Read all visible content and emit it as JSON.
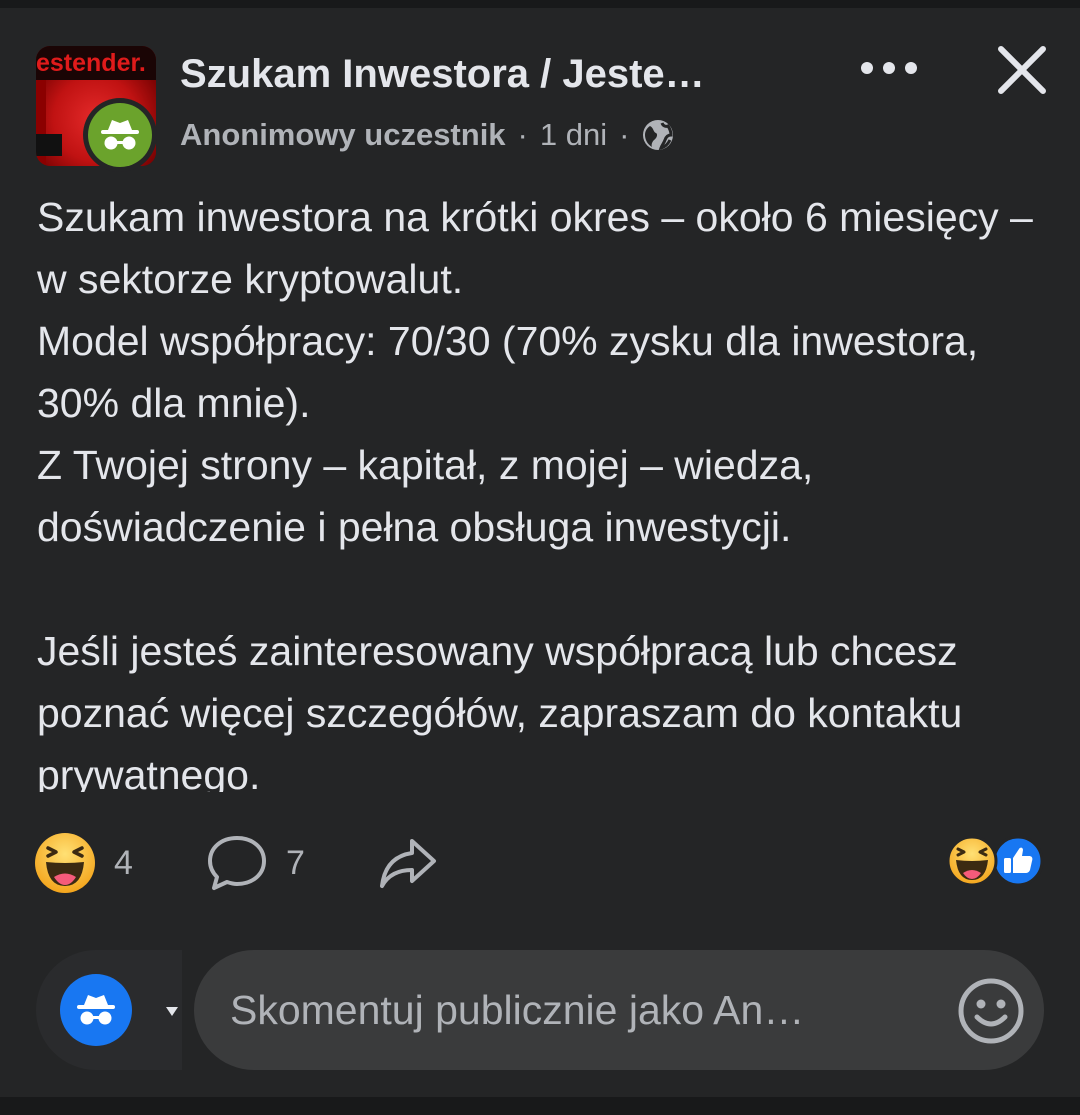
{
  "header": {
    "group_avatar_text": "estender.",
    "group_title": "Szukam Inwestora / Jeste…",
    "author": "Anonimowy uczestnik",
    "separator": "·",
    "time": "1 dni",
    "audience_icon": "globe-icon",
    "more_icon": "more-dots-icon",
    "close_icon": "close-icon"
  },
  "post": {
    "text": "Szukam inwestora na krótki okres – około 6 miesięcy – w sektorze kryptowalut.\nModel współpracy: 70/30 (70% zysku dla inwestora, 30% dla mnie).\nZ Twojej strony – kapitał, z mojej – wiedza, doświadczenie i pełna obsługa inwestycji.\n\nJeśli jesteś zainteresowany współpracą lub chcesz poznać więcej szczegółów, zapraszam do kontaktu prywatnego."
  },
  "actions": {
    "reaction_count": "4",
    "comment_count": "7",
    "reaction_icons": [
      "haha-icon",
      "like-icon"
    ]
  },
  "composer": {
    "placeholder": "Skomentuj publicznie jako An…"
  },
  "colors": {
    "background": "#242526",
    "text_primary": "#e4e6eb",
    "text_secondary": "#b0b3b8",
    "input_bg": "#3a3b3c",
    "brand_blue": "#1877f2",
    "anon_green": "#6ba32c"
  }
}
